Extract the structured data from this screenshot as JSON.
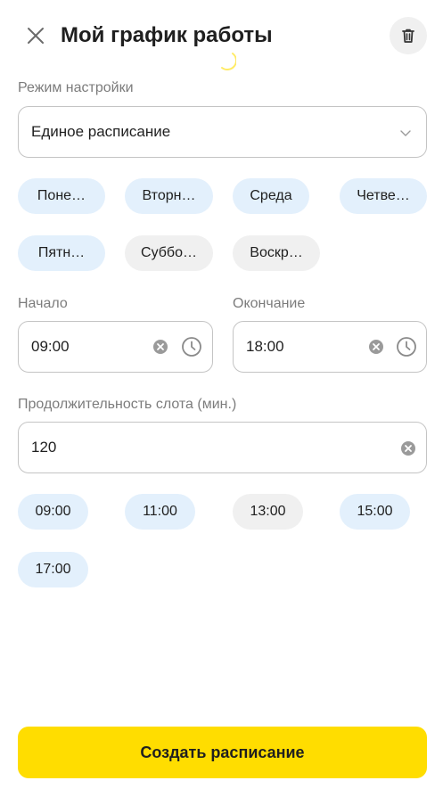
{
  "header": {
    "title": "Мой график работы",
    "close_icon": "close-icon",
    "delete_icon": "trash-icon"
  },
  "schedule_mode": {
    "label": "Режим настройки",
    "value": "Единое расписание",
    "icon": "chevron-down-icon"
  },
  "days": [
    {
      "label": "Поне…",
      "selected": true
    },
    {
      "label": "Вторн…",
      "selected": true
    },
    {
      "label": "Среда",
      "selected": true
    },
    {
      "label": "Четве…",
      "selected": true
    },
    {
      "label": "Пятн…",
      "selected": true
    },
    {
      "label": "Суббо…",
      "selected": false
    },
    {
      "label": "Воскр…",
      "selected": false
    }
  ],
  "start": {
    "label": "Начало",
    "value": "09:00"
  },
  "end": {
    "label": "Окончание",
    "value": "18:00"
  },
  "slot": {
    "label": "Продолжительность слота (мин.)",
    "value": "120"
  },
  "slots": [
    {
      "label": "09:00",
      "selected": true
    },
    {
      "label": "11:00",
      "selected": true
    },
    {
      "label": "13:00",
      "selected": false
    },
    {
      "label": "15:00",
      "selected": true
    },
    {
      "label": "17:00",
      "selected": true
    }
  ],
  "actions": {
    "create_label": "Создать расписание"
  },
  "colors": {
    "accent_yellow": "#ffdd00",
    "chip_selected": "#e3f0fc",
    "chip_unselected": "#f0f0f0",
    "spinner": "#ffdd00"
  }
}
